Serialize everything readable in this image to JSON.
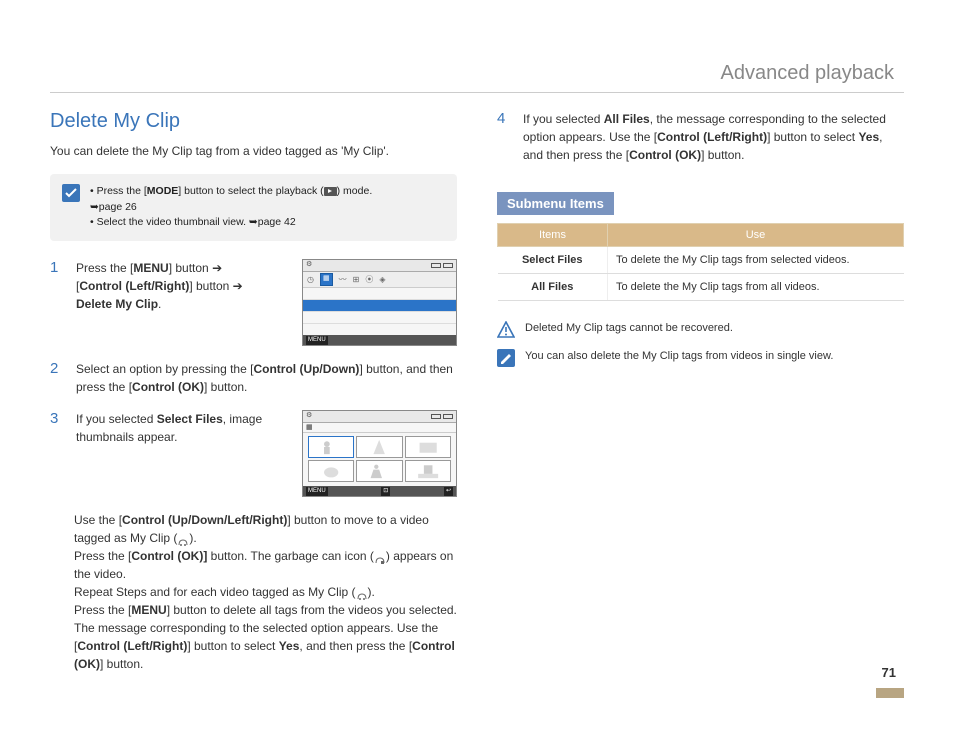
{
  "header": {
    "title": "Advanced playback"
  },
  "section": {
    "title": "Delete My Clip",
    "intro": "You can delete the My Clip tag from a video tagged as 'My Clip'."
  },
  "tips": {
    "line1a": "Press the [",
    "line1b": "MODE",
    "line1c": "] button to select the playback (",
    "line1d": ") mode.",
    "line1_ref": "➥page 26",
    "line2": "Select the video thumbnail view. ➥page 42"
  },
  "steps": {
    "s1": {
      "num": "1",
      "a": "Press the [",
      "b": "MENU",
      "c": "] button ➔",
      "d": "[",
      "e": "Control (Left/Right)",
      "f": "] button ➔",
      "g": "Delete My Clip",
      "h": "."
    },
    "s2": {
      "num": "2",
      "a": "Select an option by pressing the [",
      "b": "Control (Up/Down)",
      "c": "] button, and then press the [",
      "d": "Control (OK)",
      "e": "] button."
    },
    "s3": {
      "num": "3",
      "a": "If you selected ",
      "b": "Select Files",
      "c": ", image thumbnails appear.",
      "sub_a": "Use the [",
      "sub_b": "Control (Up/Down/Left/Right)",
      "sub_c": "] button to move to a video tagged as My Clip (",
      "sub_d": ").",
      "sub_e": "Press the [",
      "sub_f": "Control (OK)]",
      "sub_g": " button. The garbage can icon (",
      "sub_h": ") appears on the video.",
      "sub_i": "Repeat Steps      and      for each video tagged as My Clip (",
      "sub_j": ").",
      "sub_k": "Press the [",
      "sub_l": "MENU",
      "sub_m": "] button to delete all tags from the videos you selected.",
      "sub_n": "The message corresponding to the selected option appears. Use the [",
      "sub_o": "Control (Left/Right)",
      "sub_p": "] button to select ",
      "sub_q": "Yes",
      "sub_r": ", and then press the [",
      "sub_s": "Control (OK)",
      "sub_t": "] button."
    },
    "s4": {
      "num": "4",
      "a": "If you selected ",
      "b": "All Files",
      "c": ", the message corresponding to the selected option appears. Use the [",
      "d": "Control (Left/Right)",
      "e": "] button to select ",
      "f": "Yes",
      "g": ", and then press the [",
      "h": "Control (OK)",
      "i": "] button."
    }
  },
  "submenu": {
    "title": "Submenu Items",
    "head_items": "Items",
    "head_use": "Use",
    "rows": [
      {
        "item": "Select Files",
        "use": "To delete the My Clip tags from selected videos."
      },
      {
        "item": "All Files",
        "use": "To delete the My Clip tags from all videos."
      }
    ]
  },
  "notes": {
    "warn": "Deleted My Clip tags cannot be recovered.",
    "info": "You can also delete the My Clip tags from videos in single view."
  },
  "lcd": {
    "menu_label": "MENU",
    "return_glyph": "↩"
  },
  "page": {
    "number": "71"
  }
}
